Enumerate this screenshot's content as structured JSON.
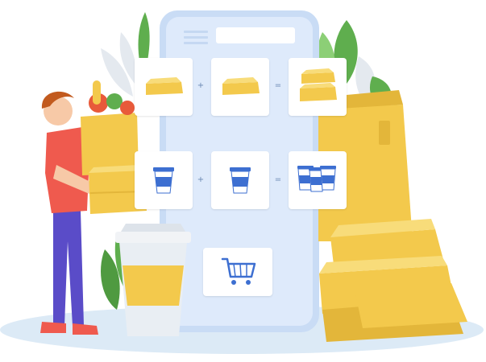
{
  "illustration": {
    "colors": {
      "phone_body": "#c9dcf5",
      "phone_screen": "#deeafb",
      "floor": "#dceaf6",
      "box_yellow": "#f3c94c",
      "cup_blue": "#3d6fd1",
      "leaf_green": "#5fae4e",
      "shirt_red": "#ef5a4e",
      "pants_purple": "#5a4cc8"
    },
    "icons": [
      "hamburger-menu-icon",
      "food-box-icon",
      "drink-cup-icon",
      "shopping-cart-icon",
      "plus-icon",
      "equals-icon"
    ]
  },
  "phone": {
    "ops": {
      "plus": "+",
      "equals": "="
    }
  }
}
